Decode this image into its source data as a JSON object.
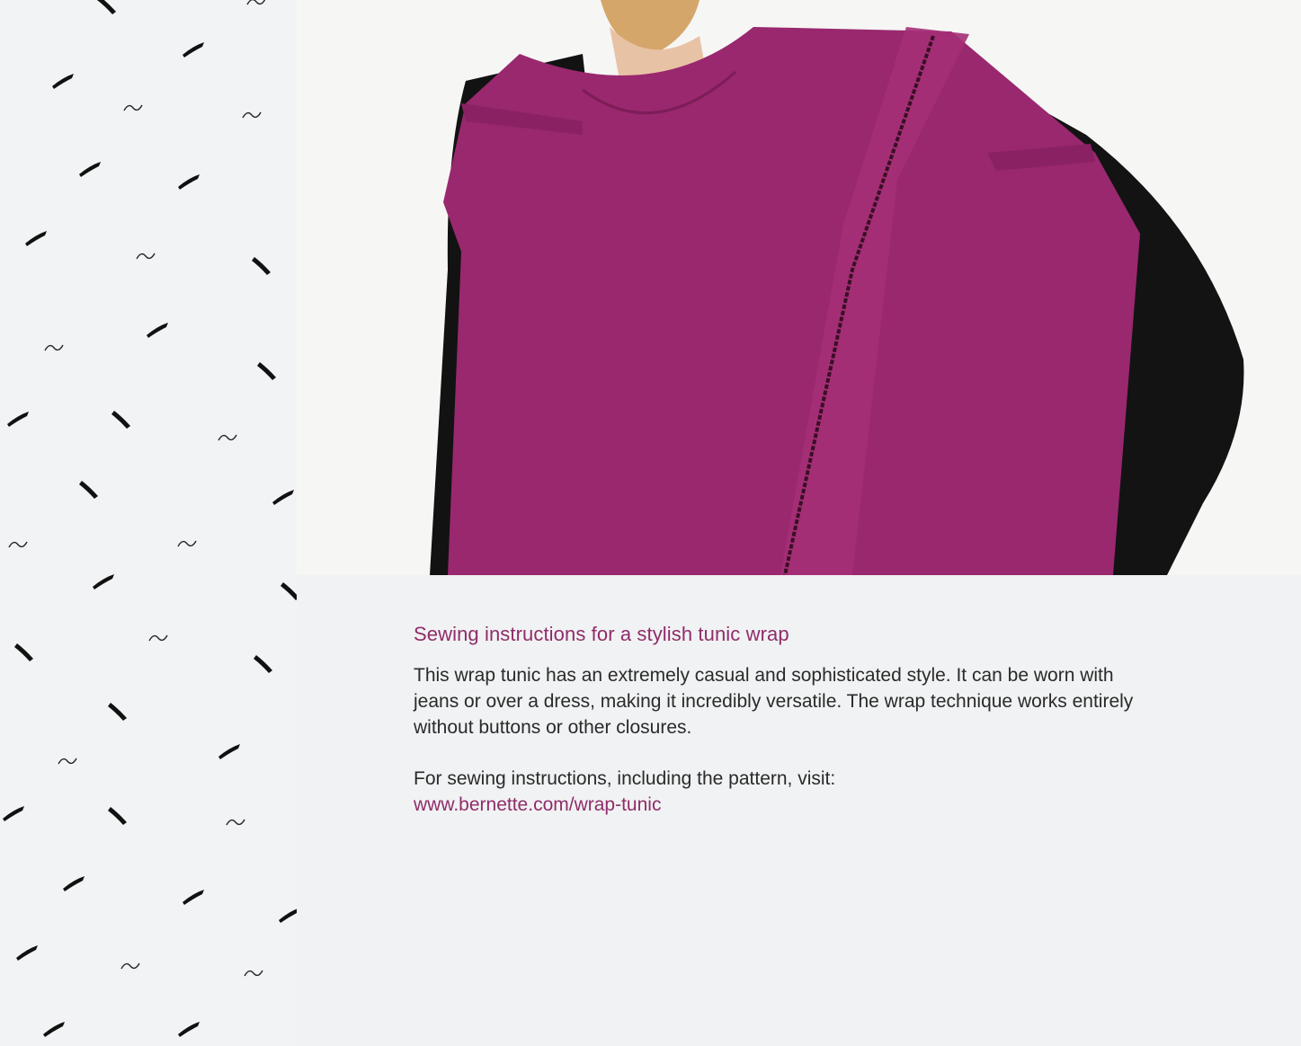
{
  "article": {
    "title": "Sewing instructions for a stylish tunic wrap",
    "body": "This wrap tunic has an extremely casual and sophisticated style. It can be worn with jeans or over a dress, making it incredibly versatile. The wrap technique works entirely without buttons or other closures.",
    "cta_text": "For sewing instructions, including the pattern, visit:",
    "link_text": "www.bernette.com/wrap-tunic"
  },
  "colors": {
    "accent": "#8e2d6a",
    "tunic": "#99286e",
    "sleeves": "#111111",
    "background": "#f2f3f4"
  },
  "icons": {
    "pattern": "stitch-mark-icon"
  }
}
